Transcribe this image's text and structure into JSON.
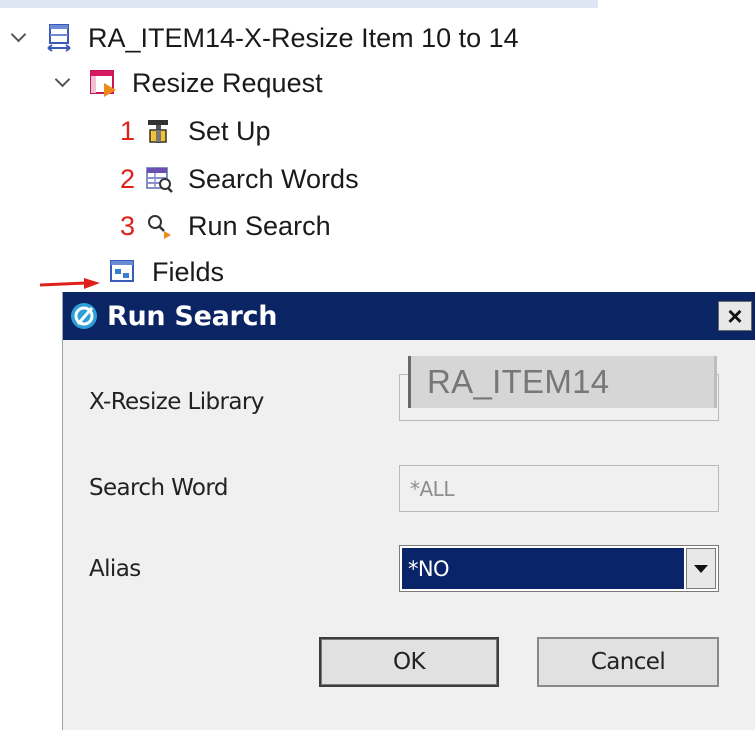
{
  "tree": {
    "root": {
      "label": "RA_ITEM14-X-Resize Item 10 to 14",
      "icon": "resize-item-icon"
    },
    "request": {
      "label": "Resize Request",
      "icon": "resize-request-icon"
    },
    "steps": [
      {
        "number": "1",
        "label": "Set Up",
        "icon": "setup-icon"
      },
      {
        "number": "2",
        "label": "Search Words",
        "icon": "search-words-icon"
      },
      {
        "number": "3",
        "label": "Run Search",
        "icon": "run-search-icon"
      }
    ],
    "fields": {
      "label": "Fields",
      "icon": "fields-icon"
    }
  },
  "dialog": {
    "title": "Run Search",
    "close_label": "×",
    "library_label": "X-Resize Library",
    "library_value": "RA_ITEM14",
    "search_word_label": "Search Word",
    "search_word_value": "*ALL",
    "alias_label": "Alias",
    "alias_value": "*NO",
    "ok_label": "OK",
    "cancel_label": "Cancel"
  },
  "colors": {
    "titlebar": "#0b2463",
    "step_number": "#e0201b",
    "annotation_arrow": "#e0201b",
    "selection": "#0a246a"
  }
}
